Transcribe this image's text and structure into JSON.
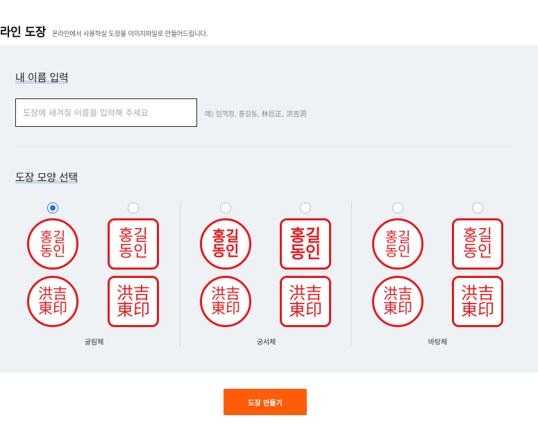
{
  "header": {
    "title": "라인 도장",
    "subtitle": "온라인에서 사용하실 도장을 이미지파일로 만들어드립니다."
  },
  "name_section": {
    "label": "내 이름 입력",
    "input_placeholder": "도장에 새겨질 이름을 입력해 주세요",
    "input_value": "",
    "example": "예) 임꺽정, 홍길동, 林巨正, 洪吉洞"
  },
  "shape_section": {
    "label": "도장 모양 선택",
    "groups": [
      {
        "font_name": "굴림체",
        "options": [
          {
            "selected": true,
            "hangul_lines": [
              "홍길",
              "동인"
            ],
            "hanja_lines": [
              "洪吉",
              "東印"
            ]
          },
          {
            "selected": false,
            "hangul_lines": [
              "홍길",
              "동인"
            ],
            "hanja_lines": [
              "洪吉",
              "東印"
            ]
          }
        ]
      },
      {
        "font_name": "궁서체",
        "options": [
          {
            "selected": false,
            "hangul_lines": [
              "홍길",
              "동인"
            ],
            "hanja_lines": [
              "洪吉",
              "東印"
            ]
          },
          {
            "selected": false,
            "hangul_lines": [
              "홍길",
              "동인"
            ],
            "hanja_lines": [
              "洪吉",
              "東印"
            ]
          }
        ]
      },
      {
        "font_name": "바탕체",
        "options": [
          {
            "selected": false,
            "hangul_lines": [
              "홍길",
              "동인"
            ],
            "hanja_lines": [
              "洪吉",
              "東印"
            ]
          },
          {
            "selected": false,
            "hangul_lines": [
              "홍길",
              "동인"
            ],
            "hanja_lines": [
              "洪吉",
              "東印"
            ]
          }
        ]
      }
    ]
  },
  "make_button": {
    "label": "도장 만들기"
  },
  "colors": {
    "stamp_red": "#e8171b",
    "radio_blue": "#1a73e8",
    "button_orange": "#ff5c0a",
    "panel_bg": "#eff2f5"
  }
}
